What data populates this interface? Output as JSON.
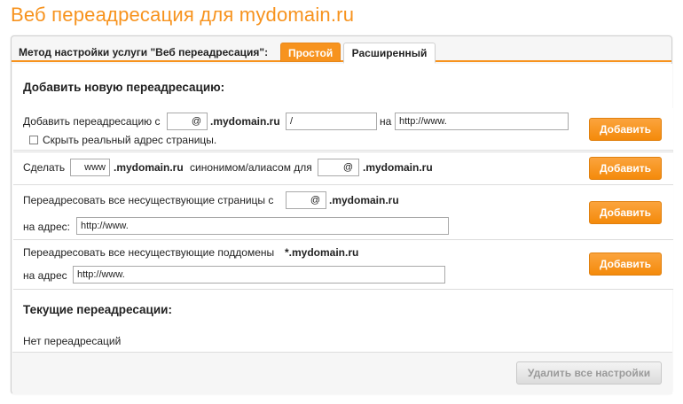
{
  "page": {
    "title": "Веб переадресация для mydomain.ru"
  },
  "method": {
    "label": "Метод настройки услуги \"Веб переадресация\":",
    "tabs": [
      {
        "label": "Простой",
        "active": false
      },
      {
        "label": "Расширенный",
        "active": true
      }
    ]
  },
  "add_section": {
    "heading": "Добавить новую переадресацию:"
  },
  "row1": {
    "prefix": "Добавить переадресацию с",
    "sub_value": "@",
    "domain": ".mydomain.ru",
    "path_value": "/",
    "to_label": "на",
    "url_value": "http://www.",
    "checkbox_label": "Скрыть реальный адрес страницы.",
    "checkbox_checked": false,
    "button": "Добавить"
  },
  "row2": {
    "prefix": "Сделать",
    "sub_value": "www",
    "domain": ".mydomain.ru",
    "middle": "синонимом/алиасом для",
    "target_value": "@",
    "domain2": ".mydomain.ru",
    "button": "Добавить"
  },
  "row3": {
    "prefix": "Переадресовать все несуществующие страницы с",
    "sub_value": "@",
    "domain": ".mydomain.ru",
    "to_label": "на адрес:",
    "url_value": "http://www.",
    "button": "Добавить"
  },
  "row4": {
    "prefix": "Переадресовать все несуществующие поддомены",
    "domain": "*.mydomain.ru",
    "to_label": "на адрес",
    "url_value": "http://www.",
    "button": "Добавить"
  },
  "current": {
    "heading": "Текущие переадресации:",
    "empty_text": "Нет переадресаций"
  },
  "footer": {
    "delete_all": "Удалить все настройки"
  },
  "colors": {
    "accent": "#f7931e",
    "button_orange": "#f48a0b",
    "border": "#dcdcdc"
  }
}
